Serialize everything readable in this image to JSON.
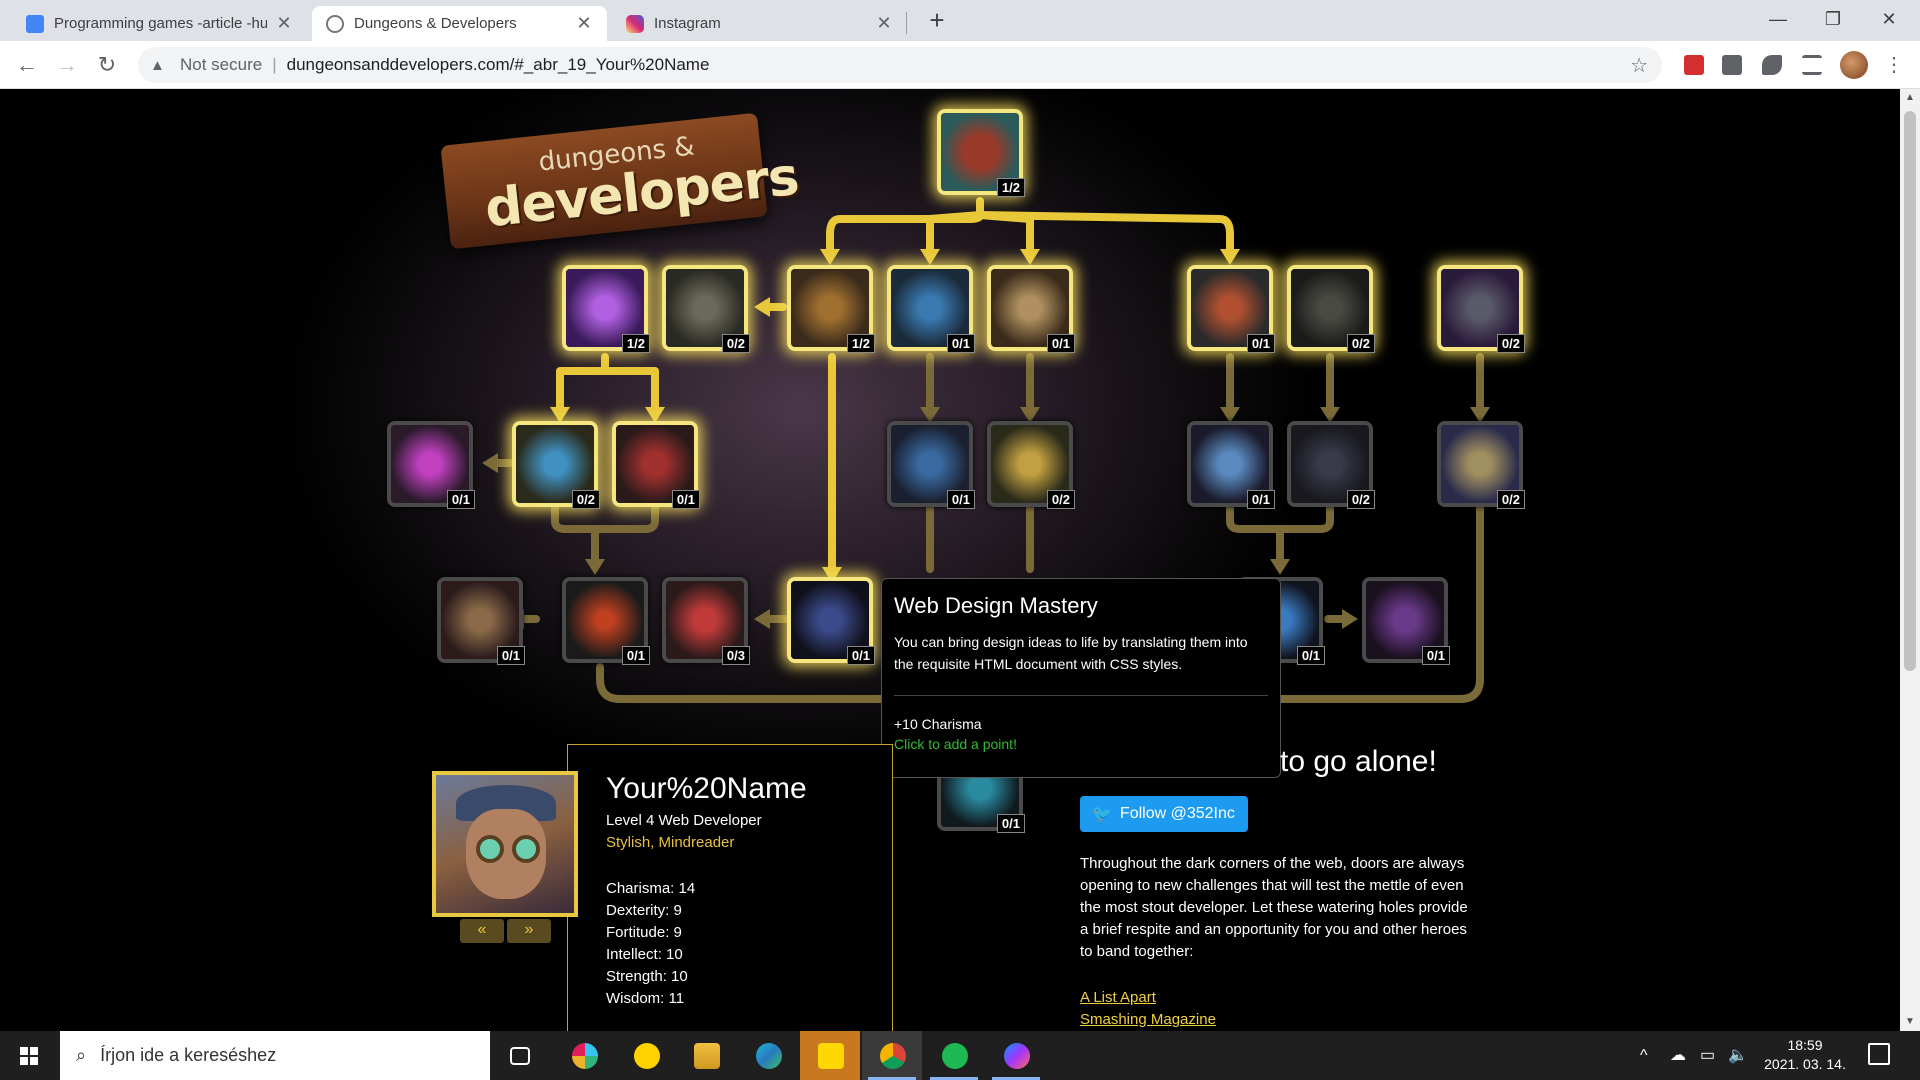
{
  "browser": {
    "tabs": [
      {
        "title": "Programming games -article -hu",
        "favicon_color": "#4285f4",
        "active": false
      },
      {
        "title": "Dungeons & Developers",
        "favicon_color": "#777777",
        "active": true
      },
      {
        "title": "Instagram",
        "favicon_color": "#d6249f",
        "active": false
      }
    ],
    "address": {
      "security_label": "Not secure",
      "url": "dungeonsanddevelopers.com/#_abr_19_Your%20Name"
    }
  },
  "logo": {
    "small": "dungeons &",
    "big": "developers"
  },
  "skills": [
    {
      "icon": "html-book-icon",
      "points": "1/2",
      "lit": true
    },
    {
      "icon": "purple-scroll-icon",
      "points": "1/2",
      "lit": true
    },
    {
      "icon": "hammer-icon",
      "points": "0/2",
      "lit": true
    },
    {
      "icon": "css-chest-icon",
      "points": "1/2",
      "lit": true
    },
    {
      "icon": "blue-scroll-icon",
      "points": "0/1",
      "lit": true
    },
    {
      "icon": "js-scroll-icon",
      "points": "0/1",
      "lit": true
    },
    {
      "icon": "pickaxe-icon",
      "points": "0/1",
      "lit": true
    },
    {
      "icon": "barrel-icon",
      "points": "0/2",
      "lit": true
    },
    {
      "icon": "dark-hammer-icon",
      "points": "0/2",
      "lit": true
    },
    {
      "icon": "potion-icon",
      "points": "0/1",
      "lit": false
    },
    {
      "icon": "magic-brush-icon",
      "points": "0/2",
      "lit": true
    },
    {
      "icon": "red-mage-icon",
      "points": "0/1",
      "lit": true
    },
    {
      "icon": "crystal-icon",
      "points": "0/1",
      "lit": false
    },
    {
      "icon": "gold-hammer-icon",
      "points": "0/2",
      "lit": false
    },
    {
      "icon": "lightning-staff-icon",
      "points": "0/1",
      "lit": false
    },
    {
      "icon": "barrel-dark-icon",
      "points": "0/2",
      "lit": false
    },
    {
      "icon": "ship-icon",
      "points": "0/2",
      "lit": false
    },
    {
      "icon": "parchment-icon",
      "points": "0/1",
      "lit": false
    },
    {
      "icon": "aura-figure-icon",
      "points": "0/1",
      "lit": false
    },
    {
      "icon": "red-orb-icon",
      "points": "0/3",
      "lit": false
    },
    {
      "icon": "shadow-figure-icon",
      "points": "0/1",
      "lit": true
    },
    {
      "icon": "blue-wisp-icon",
      "points": "0/1",
      "lit": false
    },
    {
      "icon": "purple-rune-icon",
      "points": "0/1",
      "lit": false
    },
    {
      "icon": "teal-gear-icon",
      "points": "0/1",
      "lit": false
    }
  ],
  "tooltip": {
    "title": "Web Design Mastery",
    "description": "You can bring design ideas to life by translating them into the requisite HTML document with CSS styles.",
    "stat": "+10 Charisma",
    "action": "Click to add a point!"
  },
  "character": {
    "name": "Your%20Name",
    "level": "Level 4 Web Developer",
    "traits": "Stylish, Mindreader",
    "stats": [
      "Charisma: 14",
      "Dexterity: 9",
      "Fortitude: 9",
      "Intellect: 10",
      "Strength: 10",
      "Wisdom: 11"
    ],
    "prev": "«",
    "next": "»"
  },
  "social": {
    "headline": "to go alone!",
    "follow": "Follow @352Inc",
    "blurb": "Throughout the dark corners of the web, doors are always opening to new challenges that will test the mettle of even the most stout developer. Let these watering holes provide a brief respite and an opportunity for you and other heroes to band together:",
    "links": [
      "A List Apart",
      "Smashing Magazine"
    ]
  },
  "taskbar": {
    "search_placeholder": "Írjon ide a kereséshez",
    "time": "18:59",
    "date": "2021. 03. 14.",
    "apps": [
      {
        "icon": "task-view-icon",
        "color": "#ffffff"
      },
      {
        "icon": "slack-icon",
        "color": "#e01e5a"
      },
      {
        "icon": "norton-icon",
        "color": "#ffd200"
      },
      {
        "icon": "file-explorer-icon",
        "color": "#f0c040"
      },
      {
        "icon": "edge-icon",
        "color": "#1fb5d6"
      },
      {
        "icon": "sticky-notes-icon",
        "color": "#ffd700"
      },
      {
        "icon": "chrome-icon",
        "color": "#db4437"
      },
      {
        "icon": "spotify-icon",
        "color": "#1db954"
      },
      {
        "icon": "messenger-icon",
        "color": "#a334fa"
      }
    ]
  }
}
